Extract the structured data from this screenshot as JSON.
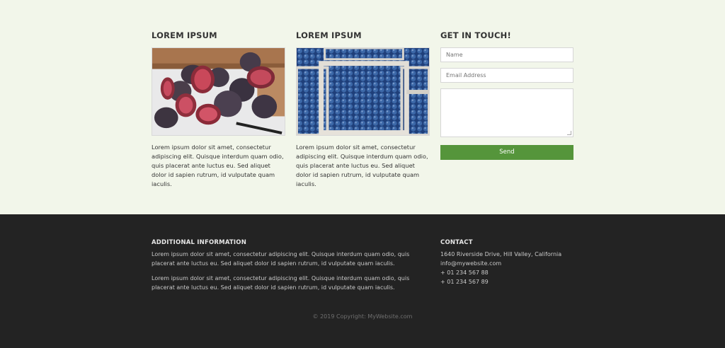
{
  "columns": [
    {
      "heading": "LOREM IPSUM",
      "image": "figs-photo",
      "text": "Lorem ipsum dolor sit amet, consectetur adipiscing elit. Quisque interdum quam odio, quis placerat ante luctus eu. Sed aliquet dolor id sapien rutrum, id vulputate quam iaculis."
    },
    {
      "heading": "LOREM IPSUM",
      "image": "blueberries-photo",
      "text": "Lorem ipsum dolor sit amet, consectetur adipiscing elit. Quisque interdum quam odio, quis placerat ante luctus eu. Sed aliquet dolor id sapien rutrum, id vulputate quam iaculis."
    }
  ],
  "contact_form": {
    "heading": "GET IN TOUCH!",
    "name_placeholder": "Name",
    "email_placeholder": "Email Address",
    "message_placeholder": "",
    "send_label": "Send",
    "send_color": "#55953b"
  },
  "footer": {
    "info_heading": "ADDITIONAL INFORMATION",
    "info_paragraphs": [
      "Lorem ipsum dolor sit amet, consectetur adipiscing elit. Quisque interdum quam odio, quis placerat ante luctus eu. Sed aliquet dolor id sapien rutrum, id vulputate quam iaculis.",
      "Lorem ipsum dolor sit amet, consectetur adipiscing elit. Quisque interdum quam odio, quis placerat ante luctus eu. Sed aliquet dolor id sapien rutrum, id vulputate quam iaculis."
    ],
    "contact_heading": "CONTACT",
    "contact_lines": [
      "1640 Riverside Drive, Hill Valley, California",
      "info@mywebsite.com",
      "+ 01 234 567 88",
      "+ 01 234 567 89"
    ],
    "copyright": "© 2019 Copyright: MyWebsite.com"
  },
  "colors": {
    "page_background": "#f2f6ea",
    "footer_background": "#232323",
    "accent": "#55953b"
  }
}
